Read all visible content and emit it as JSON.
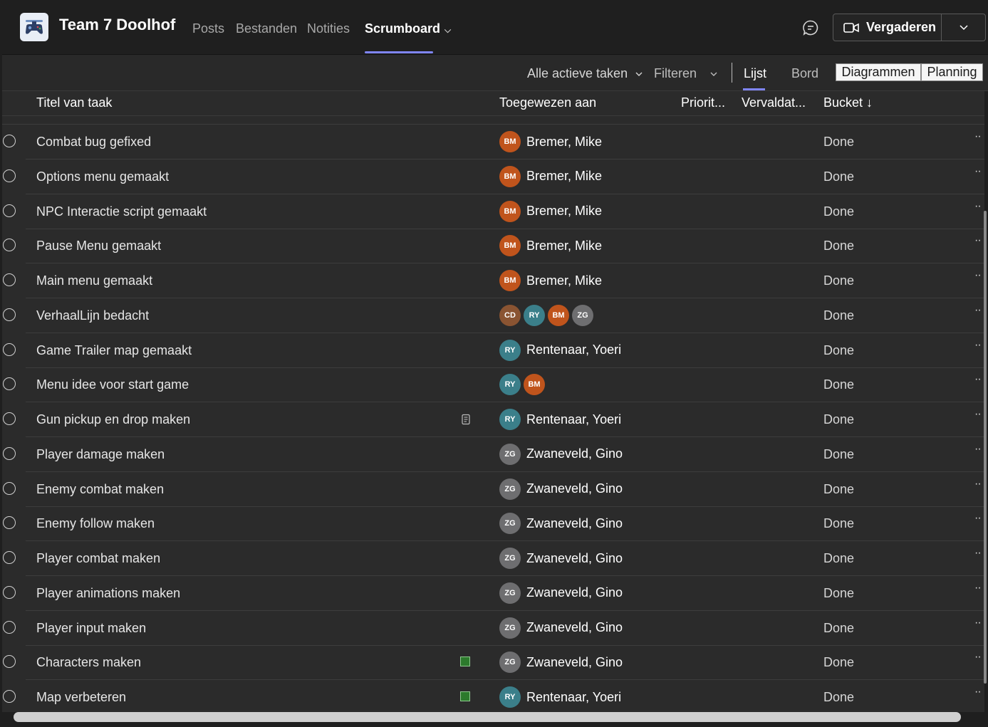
{
  "header": {
    "team_name": "Team 7 Doolhof",
    "tabs": [
      {
        "label": "Posts"
      },
      {
        "label": "Bestanden"
      },
      {
        "label": "Notities"
      },
      {
        "label": "Scrumboard"
      }
    ],
    "active_tab": "Scrumboard",
    "meet_label": "Vergaderen",
    "accent_color": "#7f85f5"
  },
  "toolbar": {
    "filter_active": "Alle actieve taken",
    "filter_label": "Filteren",
    "views": {
      "list": "Lijst",
      "board": "Bord",
      "charts": "Diagrammen",
      "schedule": "Planning"
    },
    "active_view": "Lijst"
  },
  "table": {
    "columns": {
      "title": "Titel van taak",
      "assigned": "Toegewezen aan",
      "priority": "Priorit...",
      "due": "Vervaldat...",
      "bucket": "Bucket ↓"
    },
    "rows": [
      {
        "title": "Combat bug gefixed",
        "initials": [
          "BM"
        ],
        "name": "Bremer, Mike",
        "bucket": "Done"
      },
      {
        "title": "Options menu gemaakt",
        "initials": [
          "BM"
        ],
        "name": "Bremer, Mike",
        "bucket": "Done"
      },
      {
        "title": "NPC Interactie script gemaakt",
        "initials": [
          "BM"
        ],
        "name": "Bremer, Mike",
        "bucket": "Done"
      },
      {
        "title": "Pause Menu gemaakt",
        "initials": [
          "BM"
        ],
        "name": "Bremer, Mike",
        "bucket": "Done"
      },
      {
        "title": "Main menu gemaakt",
        "initials": [
          "BM"
        ],
        "name": "Bremer, Mike",
        "bucket": "Done"
      },
      {
        "title": "VerhaalLijn bedacht",
        "initials": [
          "CD",
          "RY",
          "BM",
          "ZG"
        ],
        "name": "",
        "bucket": "Done"
      },
      {
        "title": "Game Trailer map gemaakt",
        "initials": [
          "RY"
        ],
        "name": "Rentenaar, Yoeri",
        "bucket": "Done"
      },
      {
        "title": "Menu idee voor start game",
        "initials": [
          "RY",
          "BM"
        ],
        "name": "",
        "bucket": "Done"
      },
      {
        "title": "Gun pickup en drop maken",
        "initials": [
          "RY"
        ],
        "name": "Rentenaar, Yoeri",
        "bucket": "Done",
        "icon": "note-icon"
      },
      {
        "title": "Player damage maken",
        "initials": [
          "ZG"
        ],
        "name": "Zwaneveld, Gino",
        "bucket": "Done"
      },
      {
        "title": "Enemy combat maken",
        "initials": [
          "ZG"
        ],
        "name": "Zwaneveld, Gino",
        "bucket": "Done"
      },
      {
        "title": "Enemy follow maken",
        "initials": [
          "ZG"
        ],
        "name": "Zwaneveld, Gino",
        "bucket": "Done"
      },
      {
        "title": "Player combat maken",
        "initials": [
          "ZG"
        ],
        "name": "Zwaneveld, Gino",
        "bucket": "Done"
      },
      {
        "title": "Player animations maken",
        "initials": [
          "ZG"
        ],
        "name": "Zwaneveld, Gino",
        "bucket": "Done"
      },
      {
        "title": "Player input maken",
        "initials": [
          "ZG"
        ],
        "name": "Zwaneveld, Gino",
        "bucket": "Done"
      },
      {
        "title": "Characters maken",
        "initials": [
          "ZG"
        ],
        "name": "Zwaneveld, Gino",
        "bucket": "Done",
        "icon": "green-label"
      },
      {
        "title": "Map verbeteren",
        "initials": [
          "RY"
        ],
        "name": "Rentenaar, Yoeri",
        "bucket": "Done",
        "icon": "green-label"
      }
    ]
  },
  "avatar_colors": {
    "BM": "#c0541c",
    "RY": "#3b7f8a",
    "ZG": "#6e6e70",
    "CD": "#8a5432"
  },
  "row_more_label": "··"
}
